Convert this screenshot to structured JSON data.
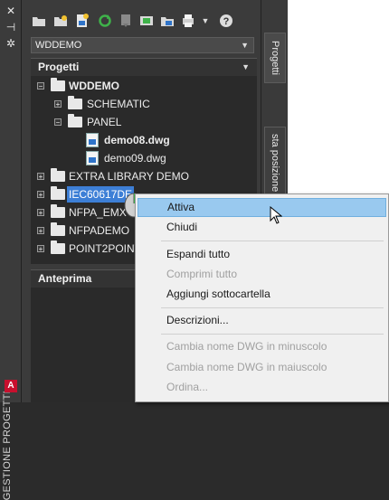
{
  "vertical_title": "GESTIONE PROGETTI",
  "toolbar_icons": [
    "open-project-icon",
    "new-project-icon",
    "new-drawing-icon",
    "refresh-icon",
    "task-list-icon",
    "project-wide-utilities-icon",
    "plot-icon",
    "publish-icon",
    "dropdown-arrow-icon",
    "help-icon"
  ],
  "project_select": {
    "value": "WDDEMO"
  },
  "projects_header": "Progetti",
  "tree": [
    {
      "label": "WDDEMO",
      "level": 0,
      "expander": "-",
      "icon": "project-folder",
      "bold": true
    },
    {
      "label": "SCHEMATIC",
      "level": 1,
      "expander": "+",
      "icon": "folder",
      "bold": false
    },
    {
      "label": "PANEL",
      "level": 1,
      "expander": "-",
      "icon": "folder",
      "bold": false
    },
    {
      "label": "demo08.dwg",
      "level": 2,
      "expander": "",
      "icon": "dwg",
      "bold": true
    },
    {
      "label": "demo09.dwg",
      "level": 2,
      "expander": "",
      "icon": "dwg",
      "bold": false
    },
    {
      "label": "EXTRA LIBRARY DEMO",
      "level": 0,
      "expander": "+",
      "icon": "project-folder",
      "bold": false
    },
    {
      "label": "IEC60617DE",
      "level": 0,
      "expander": "+",
      "icon": "project-folder",
      "bold": false,
      "selected": true
    },
    {
      "label": "NFPA_EMX",
      "level": 0,
      "expander": "+",
      "icon": "project-folder",
      "bold": false
    },
    {
      "label": "NFPADEMO",
      "level": 0,
      "expander": "+",
      "icon": "project-folder",
      "bold": false
    },
    {
      "label": "POINT2POINT",
      "level": 0,
      "expander": "+",
      "icon": "project-folder",
      "bold": false
    }
  ],
  "preview_header": "Anteprima",
  "side_tabs": {
    "tab1": "Progetti",
    "tab2": "sta posizione"
  },
  "context_menu": [
    {
      "label": "Attiva",
      "enabled": true,
      "highlighted": true
    },
    {
      "label": "Chiudi",
      "enabled": true
    },
    {
      "separator": true
    },
    {
      "label": "Espandi tutto",
      "enabled": true
    },
    {
      "label": "Comprimi tutto",
      "enabled": false
    },
    {
      "label": "Aggiungi sottocartella",
      "enabled": true
    },
    {
      "separator": true
    },
    {
      "label": "Descrizioni...",
      "enabled": true
    },
    {
      "separator": true
    },
    {
      "label": "Cambia nome DWG in minuscolo",
      "enabled": false
    },
    {
      "label": "Cambia nome DWG in maiuscolo",
      "enabled": false
    },
    {
      "label": "Ordina...",
      "enabled": false
    }
  ],
  "colors": {
    "selection": "#3d7fd6",
    "menu_highlight": "#99c9ef",
    "panel": "#3b3b3b"
  }
}
